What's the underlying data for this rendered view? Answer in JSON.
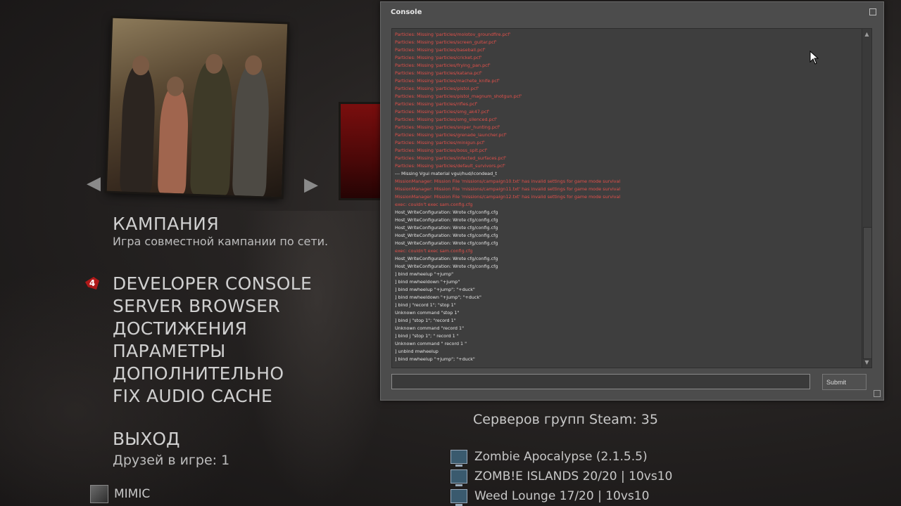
{
  "menu": {
    "title": "КАМПАНИЯ",
    "subtitle": "Игра совместной кампании по сети.",
    "marker_text": "4",
    "items": [
      {
        "label": "DEVELOPER CONSOLE"
      },
      {
        "label": "SERVER BROWSER"
      },
      {
        "label": "ДОСТИЖЕНИЯ"
      },
      {
        "label": "ПАРАМЕТРЫ"
      },
      {
        "label": "ДОПОЛНИТЕЛЬНО"
      },
      {
        "label": "FIX AUDIO CACHE"
      }
    ],
    "exit_label": "ВЫХОД",
    "friends_label": "Друзей в игре: 1",
    "friend_name": "MIMIC"
  },
  "servers": {
    "title": "Серверов групп Steam: 35",
    "items": [
      {
        "name": "Zombie Apocalypse (2.1.5.5)"
      },
      {
        "name": "ZOMB!E ISLANDS 20/20 | 10vs10"
      },
      {
        "name": "Weed Lounge 17/20 | 10vs10"
      }
    ]
  },
  "console": {
    "title": "Console",
    "input_value": "",
    "submit_label": "Submit",
    "log": [
      {
        "type": "err",
        "text": "Particles: Missing 'particles/molotov_groundfire.pcf'"
      },
      {
        "type": "err",
        "text": "Particles: Missing 'particles/screen_guitar.pcf'"
      },
      {
        "type": "err",
        "text": "Particles: Missing 'particles/baseball.pcf'"
      },
      {
        "type": "err",
        "text": "Particles: Missing 'particles/cricket.pcf'"
      },
      {
        "type": "err",
        "text": "Particles: Missing 'particles/frying_pan.pcf'"
      },
      {
        "type": "err",
        "text": "Particles: Missing 'particles/katana.pcf'"
      },
      {
        "type": "err",
        "text": "Particles: Missing 'particles/machete_knife.pcf'"
      },
      {
        "type": "err",
        "text": "Particles: Missing 'particles/pistol.pcf'"
      },
      {
        "type": "err",
        "text": "Particles: Missing 'particles/pistol_magnum_shotgun.pcf'"
      },
      {
        "type": "err",
        "text": "Particles: Missing 'particles/rifles.pcf'"
      },
      {
        "type": "err",
        "text": "Particles: Missing 'particles/smg_ak47.pcf'"
      },
      {
        "type": "err",
        "text": "Particles: Missing 'particles/smg_silenced.pcf'"
      },
      {
        "type": "err",
        "text": "Particles: Missing 'particles/sniper_hunting.pcf'"
      },
      {
        "type": "err",
        "text": "Particles: Missing 'particles/grenade_launcher.pcf'"
      },
      {
        "type": "err",
        "text": "Particles: Missing 'particles/minigun.pcf'"
      },
      {
        "type": "err",
        "text": "Particles: Missing 'particles/boss_spit.pcf'"
      },
      {
        "type": "err",
        "text": "Particles: Missing 'particles/infected_surfaces.pcf'"
      },
      {
        "type": "err",
        "text": "Particles: Missing 'particles/default_survivors.pcf'"
      },
      {
        "type": "ok",
        "text": "--- Missing Vgui material vgui/hud/icondead_t"
      },
      {
        "type": "err",
        "text": "MissionManager: Mission File 'missions/campaign10.txt' has invalid settings for game mode survival"
      },
      {
        "type": "err",
        "text": "MissionManager: Mission File 'missions/campaign11.txt' has invalid settings for game mode survival"
      },
      {
        "type": "err",
        "text": "MissionManager: Mission File 'missions/campaign12.txt' has invalid settings for game mode survival"
      },
      {
        "type": "err",
        "text": "exec: couldn't exec sam.config.cfg"
      },
      {
        "type": "ok",
        "text": "Host_WriteConfiguration: Wrote cfg/config.cfg"
      },
      {
        "type": "ok",
        "text": "Host_WriteConfiguration: Wrote cfg/config.cfg"
      },
      {
        "type": "ok",
        "text": "Host_WriteConfiguration: Wrote cfg/config.cfg"
      },
      {
        "type": "ok",
        "text": "Host_WriteConfiguration: Wrote cfg/config.cfg"
      },
      {
        "type": "ok",
        "text": "Host_WriteConfiguration: Wrote cfg/config.cfg"
      },
      {
        "type": "err",
        "text": "exec: couldn't exec sam.config.cfg"
      },
      {
        "type": "ok",
        "text": "Host_WriteConfiguration: Wrote cfg/config.cfg"
      },
      {
        "type": "ok",
        "text": "Host_WriteConfiguration: Wrote cfg/config.cfg"
      },
      {
        "type": "ok",
        "text": "] bind mwheelup \"+jump\""
      },
      {
        "type": "ok",
        "text": "] bind mwheeldown \"+jump\""
      },
      {
        "type": "ok",
        "text": "] bind mwheelup \"+jump\"; \"+duck\""
      },
      {
        "type": "ok",
        "text": "] bind mwheeldown \"+jump\"; \"+duck\""
      },
      {
        "type": "ok",
        "text": "] bind j \"record 1\"; \"stop 1\""
      },
      {
        "type": "ok",
        "text": "Unknown command \"stop 1\""
      },
      {
        "type": "ok",
        "text": "] bind j \"stop 1\"; \"record 1\""
      },
      {
        "type": "ok",
        "text": "Unknown command \"record 1\""
      },
      {
        "type": "ok",
        "text": "] bind j \"stop 1\"; \" record 1 \""
      },
      {
        "type": "ok",
        "text": "Unknown command \" record 1 \""
      },
      {
        "type": "ok",
        "text": "] unbind mwheelup"
      },
      {
        "type": "ok",
        "text": "] bind mwheelup \"+jump\"; \"+duck\""
      }
    ]
  },
  "colors": {
    "error_text": "#e2504a",
    "normal_text": "#e6e6e6",
    "console_bg": "#4c4c4c",
    "marker_red": "#b51818"
  },
  "icons": {
    "prev": "chevron-left-icon",
    "next": "chevron-right-icon",
    "server": "monitor-icon",
    "close": "window-close-icon"
  }
}
